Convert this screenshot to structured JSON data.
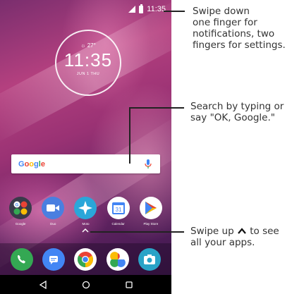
{
  "status_bar": {
    "time": "11:35",
    "signal_icon": "signal-icon",
    "battery_icon": "battery-icon"
  },
  "clock_widget": {
    "weather": "☼ 27°",
    "time": "11:35",
    "date": "JUN 1 THU"
  },
  "search_bar": {
    "logo": "Google",
    "mic_icon": "mic-icon"
  },
  "apps": [
    {
      "label": "Google",
      "icon": "google-folder-icon"
    },
    {
      "label": "Duo",
      "icon": "duo-icon"
    },
    {
      "label": "Moto",
      "icon": "moto-icon"
    },
    {
      "label": "Calendar",
      "icon": "calendar-icon",
      "badge": "31"
    },
    {
      "label": "Play Store",
      "icon": "play-store-icon"
    }
  ],
  "dock": [
    {
      "icon": "phone-icon"
    },
    {
      "icon": "messages-icon"
    },
    {
      "icon": "chrome-icon"
    },
    {
      "icon": "photos-icon"
    },
    {
      "icon": "camera-icon"
    }
  ],
  "navbar": {
    "back": "back-icon",
    "home": "home-icon",
    "recents": "recents-icon"
  },
  "callouts": {
    "notifications": [
      "Swipe down",
      "one finger for",
      "notifications, two",
      "fingers for settings."
    ],
    "search": [
      "Search by typing or",
      "say \"OK, Google.\""
    ],
    "apps_line1_a": "Swipe up",
    "apps_line1_b": "to see",
    "apps_line2": "all your apps."
  },
  "colors": {
    "google_blue": "#4285F4",
    "google_red": "#EA4335",
    "google_yellow": "#FBBC05",
    "google_green": "#34A853"
  }
}
